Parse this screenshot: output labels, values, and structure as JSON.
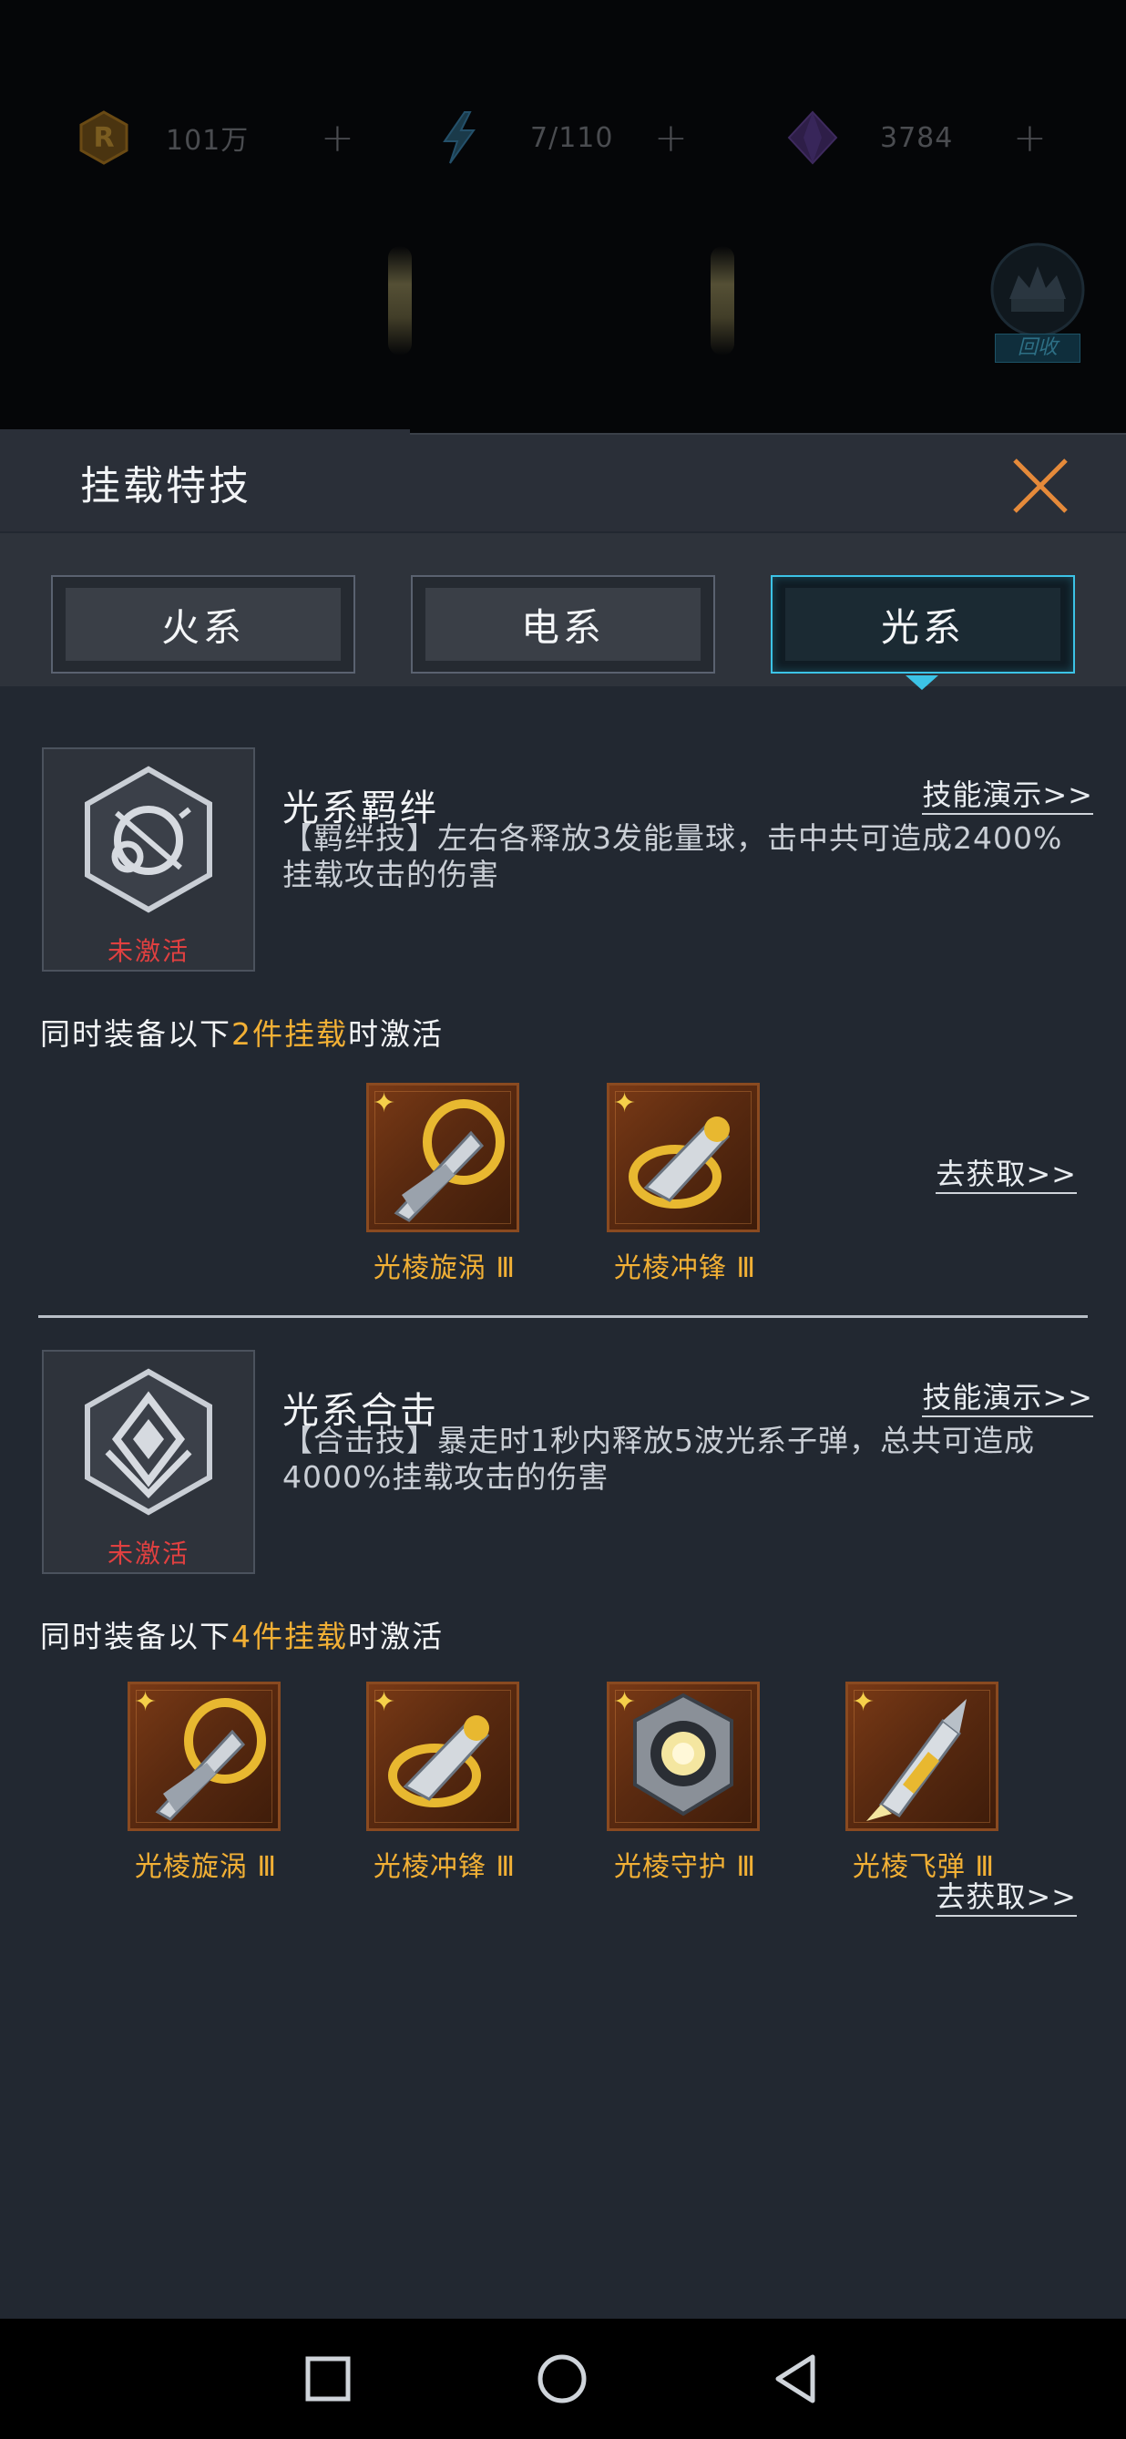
{
  "resources": {
    "coins": "101万",
    "energy": "7/110",
    "gems": "3784",
    "plus": "+"
  },
  "recycle_label": "回收",
  "panel": {
    "title": "挂载特技",
    "tabs": [
      {
        "label": "火系",
        "active": false
      },
      {
        "label": "电系",
        "active": false
      },
      {
        "label": "光系",
        "active": true
      }
    ]
  },
  "skills": [
    {
      "name": "光系羁绊",
      "status": "未激活",
      "demo": "技能演示>>",
      "desc": "【羁绊技】左右各释放3发能量球，击中共可造成2400%挂载攻击的伤害",
      "req_prefix": "同时装备以下",
      "req_highlight": "2件挂载",
      "req_suffix": "时激活",
      "items": [
        "光棱旋涡 Ⅲ",
        "光棱冲锋 Ⅲ"
      ],
      "get": "去获取>>"
    },
    {
      "name": "光系合击",
      "status": "未激活",
      "demo": "技能演示>>",
      "desc": "【合击技】暴走时1秒内释放5波光系子弹，总共可造成4000%挂载攻击的伤害",
      "req_prefix": "同时装备以下",
      "req_highlight": "4件挂载",
      "req_suffix": "时激活",
      "items": [
        "光棱旋涡 Ⅲ",
        "光棱冲锋 Ⅲ",
        "光棱守护 Ⅲ",
        "光棱飞弹 Ⅲ"
      ],
      "get": "去获取>>"
    }
  ],
  "colors": {
    "accent": "#3cc3e6",
    "highlight": "#f2b035",
    "inactive": "#e04040",
    "panel_bg": "#222831"
  },
  "icons": [
    "coin-icon",
    "lightning-icon",
    "gem-icon",
    "recycle-icon",
    "close-icon",
    "square-nav-icon",
    "circle-nav-icon",
    "back-nav-icon"
  ]
}
